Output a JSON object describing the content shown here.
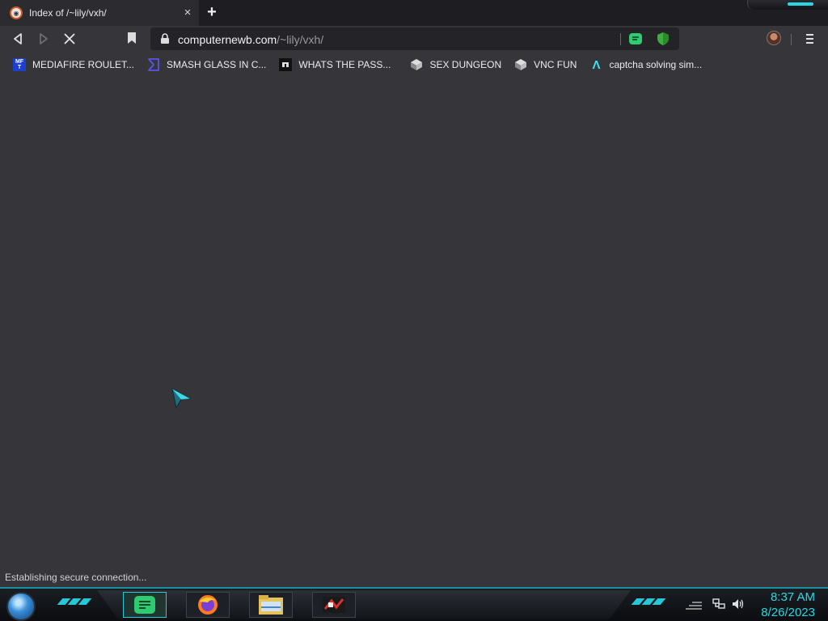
{
  "tab": {
    "title": "Index of /~lily/vxh/",
    "close": "×",
    "new_tab": "+"
  },
  "address": {
    "host": "computernewb.com",
    "path": "/~lily/vxh/"
  },
  "bookmarks": [
    {
      "label": "MEDIAFIRE ROULET...",
      "icon": "mediafire-icon",
      "icon_text": "MF T"
    },
    {
      "label": "SMASH GLASS IN C...",
      "icon": "sigma-icon"
    },
    {
      "label": "WHATS THE PASS...",
      "icon": "keyhole-icon"
    },
    {
      "label": "SEX DUNGEON",
      "icon": "cube-icon"
    },
    {
      "label": "VNC FUN",
      "icon": "cube-icon"
    },
    {
      "label": "captcha solving sim...",
      "icon": "lambda-icon",
      "icon_text": "Λ"
    }
  ],
  "status": "Establishing secure connection...",
  "clock": {
    "time": "8:37 AM",
    "date": "8/26/2023"
  },
  "colors": {
    "accent": "#27d8e3",
    "page_bg": "#36363a",
    "omnibox_bg": "#242428",
    "tab_bg": "#2b2b30"
  },
  "taskbar_apps": [
    "chat-app-icon",
    "firefox-icon",
    "file-explorer-icon",
    "media-app-icon"
  ]
}
